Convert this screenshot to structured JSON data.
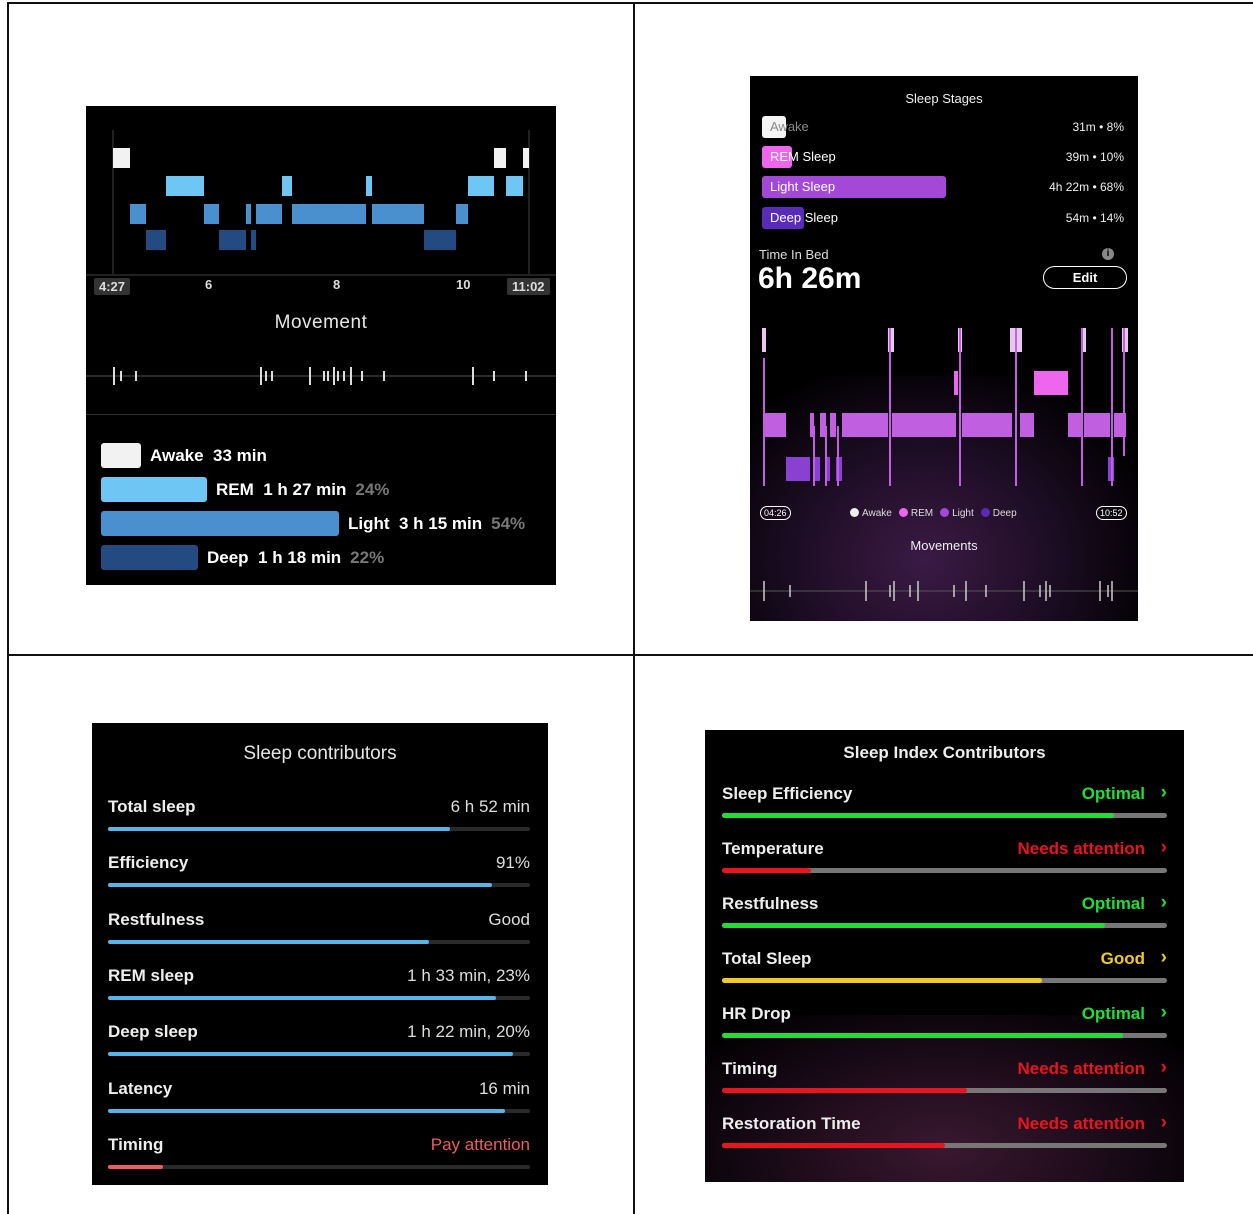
{
  "panel1": {
    "time_start": "4:27",
    "time_end": "11:02",
    "hour_ticks": [
      "6",
      "8",
      "10"
    ],
    "movement_title": "Movement",
    "legend": [
      {
        "stage": "Awake",
        "duration": "33 min",
        "percent": "",
        "color": "#f2f2f2"
      },
      {
        "stage": "REM",
        "duration": "1 h 27 min",
        "percent": "24%",
        "color": "#6ec6f5"
      },
      {
        "stage": "Light",
        "duration": "3 h 15 min",
        "percent": "54%",
        "color": "#4a90cf"
      },
      {
        "stage": "Deep",
        "duration": "1 h 18 min",
        "percent": "22%",
        "color": "#234b82"
      }
    ]
  },
  "panel2": {
    "title": "Sleep Stages",
    "stages": [
      {
        "label": "Awake",
        "value": "31m • 8%",
        "fraction": 0.08,
        "color": "#f5f5f5"
      },
      {
        "label": "REM Sleep",
        "value": "39m • 10%",
        "fraction": 0.1,
        "color": "#ee66ee"
      },
      {
        "label": "Light Sleep",
        "value": "4h 22m • 68%",
        "fraction": 0.68,
        "color": "#a448d8"
      },
      {
        "label": "Deep Sleep",
        "value": "54m • 14%",
        "fraction": 0.14,
        "color": "#5a2ab8"
      }
    ],
    "time_in_bed_label": "Time In Bed",
    "time_in_bed_value": "6h 26m",
    "edit_label": "Edit",
    "time_start": "04:26",
    "time_end": "10:52",
    "legend": [
      "Awake",
      "REM",
      "Light",
      "Deep"
    ],
    "movements_title": "Movements"
  },
  "panel3": {
    "title": "Sleep contributors",
    "items": [
      {
        "name": "Total sleep",
        "value": "6 h 52 min",
        "level": 0.81,
        "color": "#58b4e8",
        "value_color": "#dddddd"
      },
      {
        "name": "Efficiency",
        "value": "91%",
        "level": 0.91,
        "color": "#58b4e8",
        "value_color": "#dddddd"
      },
      {
        "name": "Restfulness",
        "value": "Good",
        "level": 0.76,
        "color": "#58b4e8",
        "value_color": "#dddddd"
      },
      {
        "name": "REM sleep",
        "value": "1 h 33 min, 23%",
        "level": 0.92,
        "color": "#58b4e8",
        "value_color": "#dddddd"
      },
      {
        "name": "Deep sleep",
        "value": "1 h 22 min, 20%",
        "level": 0.96,
        "color": "#58b4e8",
        "value_color": "#dddddd"
      },
      {
        "name": "Latency",
        "value": "16 min",
        "level": 0.94,
        "color": "#58b4e8",
        "value_color": "#dddddd"
      },
      {
        "name": "Timing",
        "value": "Pay attention",
        "level": 0.13,
        "color": "#e86060",
        "value_color": "#e86060"
      }
    ]
  },
  "panel4": {
    "title": "Sleep Index Contributors",
    "items": [
      {
        "name": "Sleep Efficiency",
        "status": "Optimal",
        "level": 0.88,
        "color": "#22dd33"
      },
      {
        "name": "Temperature",
        "status": "Needs attention",
        "level": 0.2,
        "color": "#e8141e"
      },
      {
        "name": "Restfulness",
        "status": "Optimal",
        "level": 0.86,
        "color": "#22dd33"
      },
      {
        "name": "Total Sleep",
        "status": "Good",
        "level": 0.72,
        "color": "#f0c828"
      },
      {
        "name": "HR Drop",
        "status": "Optimal",
        "level": 0.9,
        "color": "#22dd33"
      },
      {
        "name": "Timing",
        "status": "Needs attention",
        "level": 0.55,
        "color": "#e8141e"
      },
      {
        "name": "Restoration Time",
        "status": "Needs attention",
        "level": 0.5,
        "color": "#e8141e"
      }
    ]
  }
}
